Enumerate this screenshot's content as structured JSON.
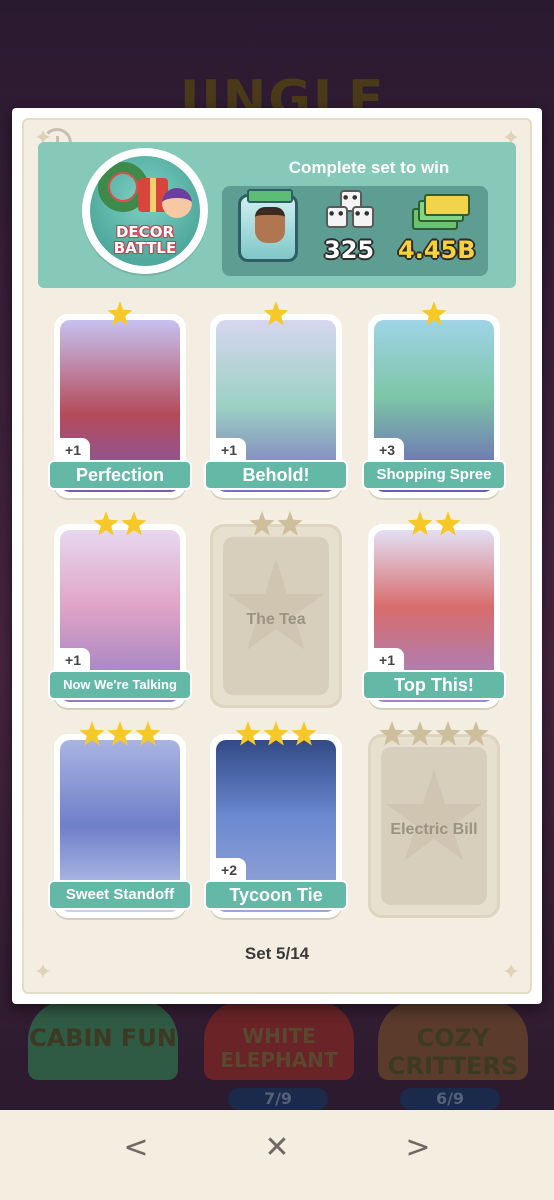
{
  "background": {
    "title": "JINGLE",
    "tiles": [
      {
        "label": "CABIN FUN"
      },
      {
        "label": "WHITE ELEPHANT"
      },
      {
        "label": "COZY CRITTERS"
      }
    ],
    "progress": [
      "7/9",
      "6/9"
    ]
  },
  "header": {
    "badge_line1": "DECOR",
    "badge_line2": "BATTLE",
    "title": "Complete set to win",
    "rewards": {
      "dice": "325",
      "cash": "4.45B"
    }
  },
  "stickers": [
    {
      "name": "Perfection",
      "stars": 1,
      "owned": true,
      "extra": "+1"
    },
    {
      "name": "Behold!",
      "stars": 1,
      "owned": true,
      "extra": "+1"
    },
    {
      "name": "Shopping Spree",
      "stars": 1,
      "owned": true,
      "extra": "+3"
    },
    {
      "name": "Now We're Talking",
      "stars": 2,
      "owned": true,
      "extra": "+1"
    },
    {
      "name": "The Tea",
      "stars": 2,
      "owned": false,
      "extra": ""
    },
    {
      "name": "Top This!",
      "stars": 2,
      "owned": true,
      "extra": "+1"
    },
    {
      "name": "Sweet Standoff",
      "stars": 3,
      "owned": true,
      "extra": ""
    },
    {
      "name": "Tycoon Tie",
      "stars": 3,
      "owned": true,
      "extra": "+2"
    },
    {
      "name": "Electric Bill",
      "stars": 4,
      "owned": false,
      "extra": ""
    }
  ],
  "set_label": "Set 5/14",
  "nav": {
    "prev": "<",
    "close": "✕",
    "next": ">"
  },
  "colors": {
    "header_bg": "#86c9b9",
    "label_bg": "#64b9a6",
    "star_gold": "#f6c928",
    "star_grey": "#cdbf9c"
  }
}
